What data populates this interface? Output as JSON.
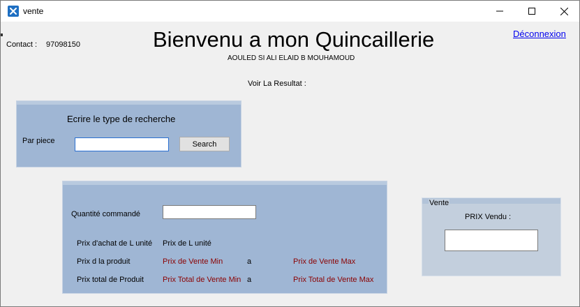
{
  "window": {
    "title": "vente",
    "icon": "app-tools-icon",
    "controls": [
      "minimize-icon",
      "maximize-icon",
      "close-icon"
    ]
  },
  "header": {
    "contact_label": "Contact :",
    "contact_value": "97098150",
    "title": "Bienvenu a mon Quincaillerie",
    "subtitle": "AOULED SI ALI ELAID B MOUHAMOUD",
    "logout": "Déconnexion",
    "result_label": "Voir La Resultat :"
  },
  "search_panel": {
    "heading": "Ecrire le type de recherche",
    "field_label": "Par piece",
    "field_value": "",
    "button_label": "Search"
  },
  "product_panel": {
    "quantity_label": "Quantité commandé",
    "quantity_value": "",
    "rows": [
      {
        "label": "Prix d'achat de L unité",
        "col1": "Prix de L unité",
        "sep": "",
        "col2": ""
      },
      {
        "label": "Prix d la produit",
        "col1": "Prix de Vente Min",
        "sep": "a",
        "col2": "Prix de Vente Max"
      },
      {
        "label": "Prix total de Produit",
        "col1": "Prix Total de Vente Min",
        "sep": "a",
        "col2": "Prix Total de Vente Max"
      }
    ]
  },
  "vente_panel": {
    "legend": "Vente",
    "label": "PRIX Vendu :",
    "value": ""
  },
  "colors": {
    "panel": "#9fb6d4",
    "vente_panel": "#c3cfdd",
    "link": "#0000ee",
    "result_text": "#8b0000"
  }
}
